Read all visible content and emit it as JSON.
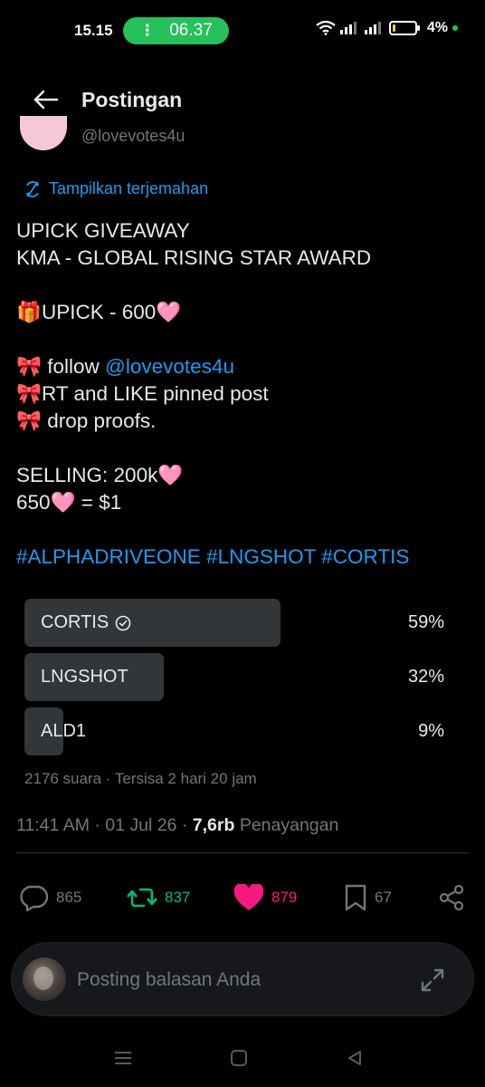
{
  "status_bar": {
    "time": "15.15",
    "call_duration": "06.37",
    "battery": "4%"
  },
  "header": {
    "title": "Postingan"
  },
  "author": {
    "handle": "@lovevotes4u"
  },
  "translate_label": "Tampilkan terjemahan",
  "post": {
    "line1": "UPICK GIVEAWAY",
    "line2": "KMA - GLOBAL RISING STAR AWARD",
    "line3": "🎁UPICK - 600🩷",
    "line4_prefix": "🎀 follow ",
    "line4_mention": "@lovevotes4u",
    "line5": "🎀RT and LIKE pinned post",
    "line6": "🎀 drop proofs.",
    "line7": "SELLING: 200k🩷",
    "line8": "650🩷 = $1",
    "hashtag1": "#ALPHADRIVEONE",
    "hashtag2": "#LNGSHOT",
    "hashtag3": "#CORTIS"
  },
  "poll": {
    "options": [
      {
        "label": "CORTIS",
        "percent": "59%",
        "fraction": 0.59,
        "winner": true
      },
      {
        "label": "LNGSHOT",
        "percent": "32%",
        "fraction": 0.32,
        "winner": false
      },
      {
        "label": "ALD1",
        "percent": "9%",
        "fraction": 0.09,
        "winner": false
      }
    ],
    "meta": "2176 suara · Tersisa 2 hari 20 jam"
  },
  "timestamp": {
    "time": "11:41 AM",
    "date": "01 Jul 26",
    "views": "7,6rb",
    "views_label": "Penayangan"
  },
  "actions": {
    "replies": "865",
    "reposts": "837",
    "likes": "879",
    "bookmarks": "67"
  },
  "reply_box": {
    "placeholder": "Posting balasan Anda"
  },
  "colors": {
    "accent": "#1d9bf0",
    "repost": "#00ba7c",
    "like": "#f91880",
    "call_pill": "#25c15a"
  },
  "icons": [
    "back-arrow-icon",
    "translate-icon",
    "verified-check-icon",
    "reply-icon",
    "repost-icon",
    "heart-icon",
    "bookmark-icon",
    "share-icon",
    "expand-icon",
    "wifi-icon",
    "signal-icon",
    "battery-icon"
  ]
}
